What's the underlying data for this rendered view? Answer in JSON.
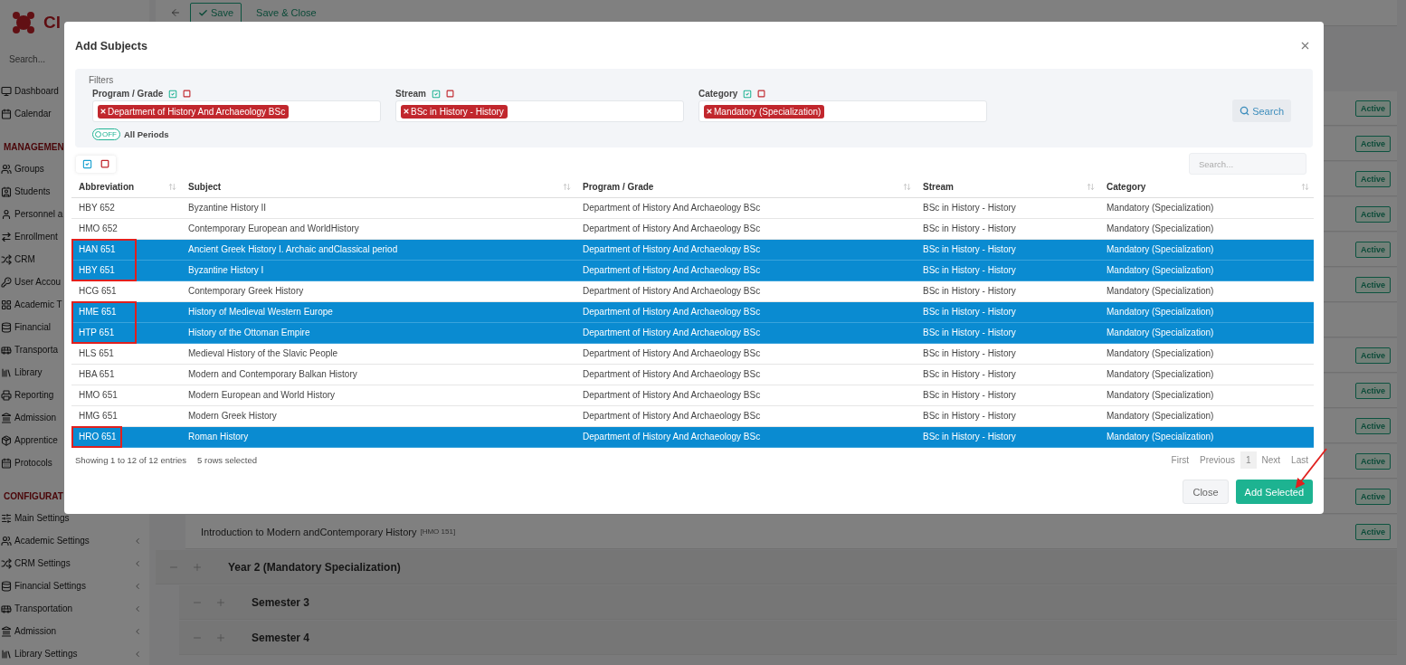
{
  "sidebar": {
    "logo": "Cl",
    "search_placeholder": "Search...",
    "items": [
      {
        "kind": "item",
        "label": "Dashboard"
      },
      {
        "kind": "item",
        "label": "Calendar"
      },
      {
        "kind": "section",
        "label": "MANAGEMEN"
      },
      {
        "kind": "item",
        "label": "Groups"
      },
      {
        "kind": "item",
        "label": "Students"
      },
      {
        "kind": "item",
        "label": "Personnel a"
      },
      {
        "kind": "item",
        "label": "Enrollment"
      },
      {
        "kind": "item",
        "label": "CRM"
      },
      {
        "kind": "item",
        "label": "User Accou"
      },
      {
        "kind": "item",
        "label": "Academic T"
      },
      {
        "kind": "item",
        "label": "Financial"
      },
      {
        "kind": "item",
        "label": "Transporta"
      },
      {
        "kind": "item",
        "label": "Library"
      },
      {
        "kind": "item",
        "label": "Reporting"
      },
      {
        "kind": "item",
        "label": "Admission"
      },
      {
        "kind": "item",
        "label": "Apprentice"
      },
      {
        "kind": "item",
        "label": "Protocols"
      },
      {
        "kind": "section",
        "label": "CONFIGURAT"
      },
      {
        "kind": "item",
        "label": "Main Settings"
      },
      {
        "kind": "item",
        "label": "Academic Settings",
        "has_submenu": true
      },
      {
        "kind": "item",
        "label": "CRM Settings",
        "has_submenu": true
      },
      {
        "kind": "item",
        "label": "Financial Settings",
        "has_submenu": true
      },
      {
        "kind": "item",
        "label": "Transportation",
        "has_submenu": true
      },
      {
        "kind": "item",
        "label": "Admission",
        "has_submenu": true
      },
      {
        "kind": "item",
        "label": "Library Settings",
        "has_submenu": true
      }
    ]
  },
  "toolbar": {
    "save": "Save",
    "save_close": "Save & Close"
  },
  "outline_rows": [
    {
      "kind": "subject",
      "status": "Active"
    },
    {
      "kind": "subject",
      "status": "Active"
    },
    {
      "kind": "subject",
      "status": "Active"
    },
    {
      "kind": "subject",
      "status": "Active"
    },
    {
      "kind": "subject",
      "status": "Active"
    },
    {
      "kind": "subject",
      "status": "Active"
    },
    {
      "kind": "subject"
    },
    {
      "kind": "subject",
      "status": "Active"
    },
    {
      "kind": "subject",
      "status": "Active"
    },
    {
      "kind": "subject",
      "status": "Active"
    },
    {
      "kind": "subject",
      "status": "Active"
    },
    {
      "kind": "subject",
      "status": "Active"
    },
    {
      "kind": "subject",
      "title": "Introduction to Modern andContemporary History",
      "code": "[HMO 151]",
      "status": "Active"
    },
    {
      "kind": "year",
      "title": "Year 2 (Mandatory Specialization)"
    },
    {
      "kind": "semester",
      "title": "Semester 3"
    },
    {
      "kind": "semester",
      "title": "Semester 4"
    }
  ],
  "modal": {
    "title": "Add Subjects",
    "filters": {
      "legend": "Filters",
      "groups": [
        {
          "label": "Program / Grade",
          "chips": [
            "Department of History And Archaeology BSc"
          ]
        },
        {
          "label": "Stream",
          "chips": [
            "BSc in History - History"
          ]
        },
        {
          "label": "Category",
          "chips": [
            "Mandatory (Specialization)"
          ]
        }
      ],
      "toggle": {
        "on": false,
        "state_label": "OFF",
        "label": "All Periods"
      },
      "search_button": "Search"
    },
    "table_search_placeholder": "Search...",
    "table": {
      "columns": [
        "Abbreviation",
        "Subject",
        "Program / Grade",
        "Stream",
        "Category"
      ],
      "rows": [
        {
          "cells": [
            "HBY 652",
            "Byzantine History II",
            "Department of History And Archaeology BSc",
            "BSc in History - History",
            "Mandatory (Specialization)"
          ],
          "selected": false,
          "annotated": false
        },
        {
          "cells": [
            "HMO 652",
            "Contemporary European and WorldHistory",
            "Department of History And Archaeology BSc",
            "BSc in History - History",
            "Mandatory (Specialization)"
          ],
          "selected": false,
          "annotated": false
        },
        {
          "cells": [
            "HAN 651",
            "Ancient Greek History I. Archaic andClassical period",
            "Department of History And Archaeology BSc",
            "BSc in History - History",
            "Mandatory (Specialization)"
          ],
          "selected": true,
          "annotated": true
        },
        {
          "cells": [
            "HBY 651",
            "Byzantine History I",
            "Department of History And Archaeology BSc",
            "BSc in History - History",
            "Mandatory (Specialization)"
          ],
          "selected": true,
          "annotated": true
        },
        {
          "cells": [
            "HCG 651",
            "Contemporary Greek History",
            "Department of History And Archaeology BSc",
            "BSc in History - History",
            "Mandatory (Specialization)"
          ],
          "selected": false,
          "annotated": false
        },
        {
          "cells": [
            "HME 651",
            "History of Medieval Western Europe",
            "Department of History And Archaeology BSc",
            "BSc in History - History",
            "Mandatory (Specialization)"
          ],
          "selected": true,
          "annotated": true
        },
        {
          "cells": [
            "HTP 651",
            "History of the Ottoman Empire",
            "Department of History And Archaeology BSc",
            "BSc in History - History",
            "Mandatory (Specialization)"
          ],
          "selected": true,
          "annotated": true
        },
        {
          "cells": [
            "HLS 651",
            "Medieval History of the Slavic People",
            "Department of History And Archaeology BSc",
            "BSc in History - History",
            "Mandatory (Specialization)"
          ],
          "selected": false,
          "annotated": false
        },
        {
          "cells": [
            "HBA 651",
            "Modern and Contemporary Balkan History",
            "Department of History And Archaeology BSc",
            "BSc in History - History",
            "Mandatory (Specialization)"
          ],
          "selected": false,
          "annotated": false
        },
        {
          "cells": [
            "HMO 651",
            "Modern European and World History",
            "Department of History And Archaeology BSc",
            "BSc in History - History",
            "Mandatory (Specialization)"
          ],
          "selected": false,
          "annotated": false
        },
        {
          "cells": [
            "HMG 651",
            "Modern Greek History",
            "Department of History And Archaeology BSc",
            "BSc in History - History",
            "Mandatory (Specialization)"
          ],
          "selected": false,
          "annotated": false
        },
        {
          "cells": [
            "HRO 651",
            "Roman History",
            "Department of History And Archaeology BSc",
            "BSc in History - History",
            "Mandatory (Specialization)"
          ],
          "selected": true,
          "annotated": true
        }
      ]
    },
    "info": "Showing 1 to 12 of 12 entries",
    "selection_info": "5 rows selected",
    "pagination": [
      {
        "label": "First",
        "selected": false
      },
      {
        "label": "Previous",
        "selected": false
      },
      {
        "label": "1",
        "selected": true
      },
      {
        "label": "Next",
        "selected": false
      },
      {
        "label": "Last",
        "selected": false
      }
    ],
    "buttons": {
      "close": "Close",
      "add": "Add Selected"
    }
  }
}
